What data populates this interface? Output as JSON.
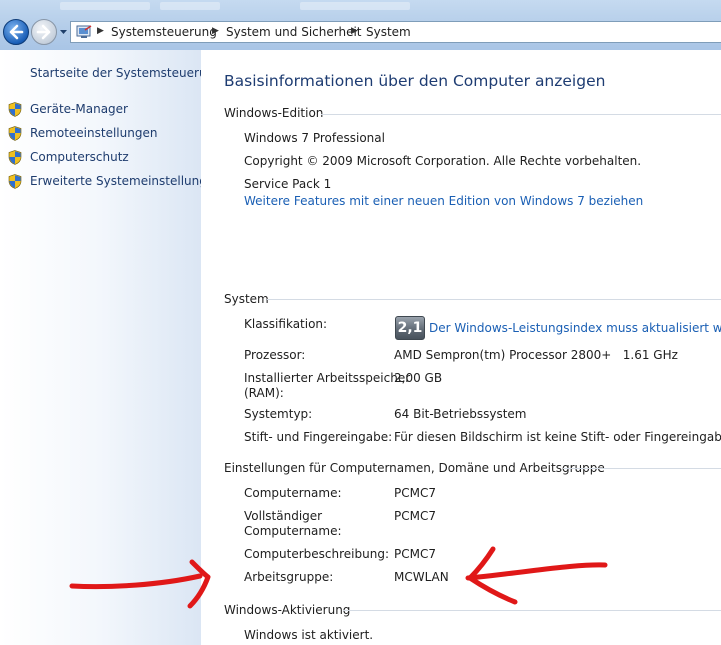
{
  "address_bar": {
    "breadcrumbs": [
      "Systemsteuerung",
      "System und Sicherheit",
      "System"
    ]
  },
  "sidebar": {
    "home_link": "Startseite der Systemsteuerung",
    "items": [
      {
        "label": "Geräte-Manager",
        "icon": "uac-shield-icon"
      },
      {
        "label": "Remoteeinstellungen",
        "icon": "uac-shield-icon"
      },
      {
        "label": "Computerschutz",
        "icon": "uac-shield-icon"
      },
      {
        "label": "Erweiterte Systemeinstellungen",
        "icon": "uac-shield-icon"
      }
    ]
  },
  "main": {
    "title": "Basisinformationen über den Computer anzeigen",
    "edition": {
      "heading": "Windows-Edition",
      "name": "Windows 7 Professional",
      "copyright": "Copyright © 2009 Microsoft Corporation. Alle Rechte vorbehalten.",
      "service_pack": "Service Pack 1",
      "upgrade_link": "Weitere Features mit einer neuen Edition von Windows 7 beziehen"
    },
    "system": {
      "heading": "System",
      "rating_label": "Klassifikation:",
      "rating_badge": "2,1",
      "rating_link": "Der Windows-Leistungsindex muss aktualisiert werden",
      "processor_label": "Prozessor:",
      "processor_value": "AMD Sempron(tm) Processor 2800+   1.61 GHz",
      "ram_label_line1": "Installierter Arbeitsspeicher",
      "ram_label_line2": "(RAM):",
      "ram_value": "2,00 GB",
      "type_label": "Systemtyp:",
      "type_value": "64 Bit-Betriebssystem",
      "pen_label": "Stift- und Fingereingabe:",
      "pen_value": "Für diesen Bildschirm ist keine Stift- oder Fingereingabe verfügbar."
    },
    "computer_name": {
      "heading": "Einstellungen für Computernamen, Domäne und Arbeitsgruppe",
      "name_label": "Computername:",
      "name_value": "PCMC7",
      "full_label_line1": "Vollständiger",
      "full_label_line2": "Computername:",
      "full_value": "PCMC7",
      "desc_label": "Computerbeschreibung:",
      "desc_value": "PCMC7",
      "workgroup_label": "Arbeitsgruppe:",
      "workgroup_value": "MCWLAN"
    },
    "activation": {
      "heading": "Windows-Aktivierung",
      "status": "Windows ist aktiviert."
    }
  },
  "annotations": {
    "arrow_color": "#e01818"
  },
  "colors": {
    "link": "#1a5fb4",
    "title": "#1e3c72"
  }
}
